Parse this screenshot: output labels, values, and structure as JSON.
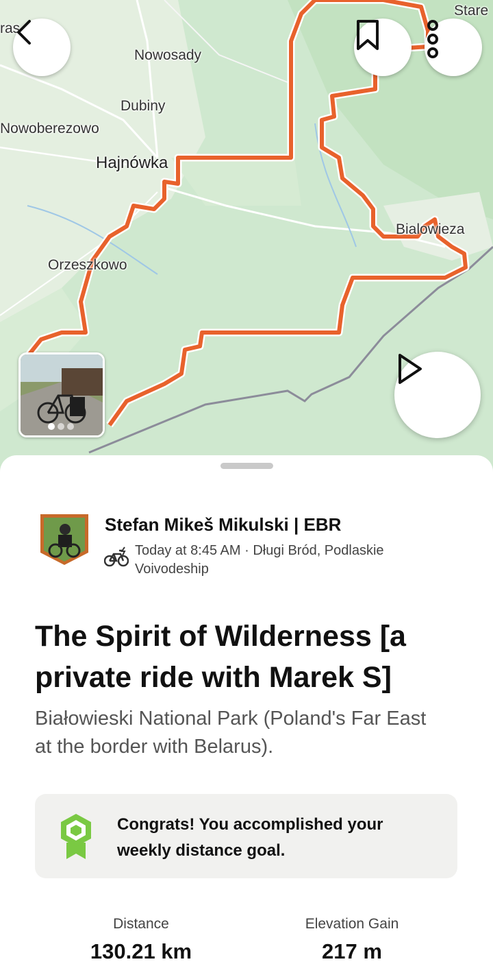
{
  "map": {
    "labels": {
      "stare": "Stare",
      "ras": "ras",
      "nowosady": "Nowosady",
      "dubiny": "Dubiny",
      "nowoberezowo": "Nowoberezowo",
      "hajnowka": "Hajnówka",
      "bialowieza": "Bialowieza",
      "orzeszkowo": "Orzeszkowo"
    },
    "route_color": "#e8622c",
    "map_color": "#cfe8cf"
  },
  "header": {
    "back_icon": "chevron-left-icon",
    "bookmark_icon": "bookmark-icon",
    "more_icon": "more-vertical-icon"
  },
  "media": {
    "photo_count": 3,
    "active_photo": 1,
    "play_icon": "play-icon"
  },
  "activity": {
    "athlete_name": "Stefan  Mikeš Mikulski | EBR",
    "activity_type_icon": "e-bike-icon",
    "meta": "Today at 8:45 AM · Długi Bród, Podlaskie Voivodeship",
    "title": "The Spirit of Wilderness [a private ride with Marek S]",
    "description": "Białowieski National Park (Poland's Far East at the border with Belarus).",
    "goal_message": "Congrats! You accomplished your weekly distance goal.",
    "goal_icon": "goal-badge-icon"
  },
  "stats": [
    {
      "label": "Distance",
      "value": "130.21 km"
    },
    {
      "label": "Elevation Gain",
      "value": "217 m"
    }
  ],
  "colors": {
    "accent": "#fc5200",
    "goal_green": "#7ac943",
    "card_bg": "#f1f1ef"
  }
}
